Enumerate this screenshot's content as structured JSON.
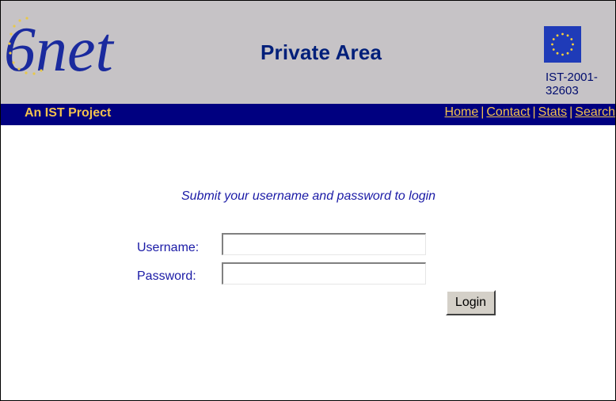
{
  "header": {
    "logo_text": "6net",
    "title": "Private Area",
    "project_code": "IST-2001-32603"
  },
  "navbar": {
    "label": "An IST Project",
    "links": [
      "Home",
      "Contact",
      "Stats",
      "Search"
    ],
    "separator": "|"
  },
  "login": {
    "prompt": "Submit your username and password to login",
    "username_label": "Username:",
    "username_value": "",
    "password_label": "Password:",
    "password_value": "",
    "button_label": "Login"
  },
  "colors": {
    "header_bg": "#c6c3c6",
    "navbar_bg": "#000080",
    "nav_text": "#f3c24e",
    "title_text": "#001f7a",
    "form_text": "#1a1aa6"
  },
  "icons": {
    "logo": "6net-logo",
    "flag": "eu-flag-icon"
  }
}
